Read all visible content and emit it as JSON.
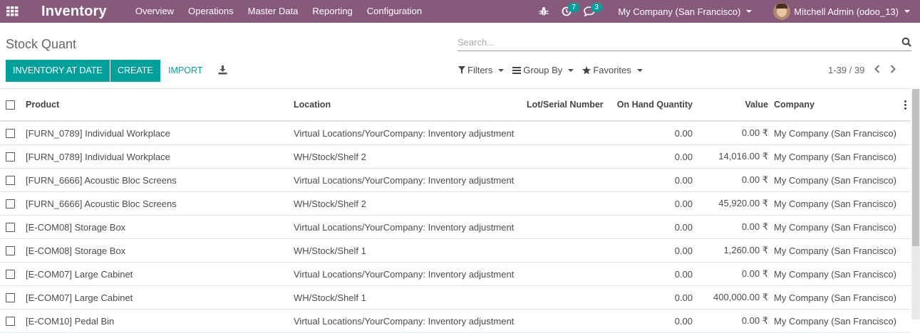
{
  "navbar": {
    "app_title": "Inventory",
    "menu": [
      "Overview",
      "Operations",
      "Master Data",
      "Reporting",
      "Configuration"
    ],
    "activity_count": "7",
    "messages_count": "3",
    "company": "My Company (San Francisco)",
    "user": "Mitchell Admin (odoo_13)",
    "icons": [
      "apps-grid-icon",
      "bug-icon",
      "clock-icon",
      "chat-icon",
      "user-avatar"
    ],
    "brand_color": "#875a7b",
    "accent_color": "#00a09d"
  },
  "control_panel": {
    "title": "Stock Quant",
    "search_placeholder": "Search...",
    "buttons": {
      "inventory_at_date": "Inventory at Date",
      "create": "Create",
      "import": "Import"
    },
    "filters": "Filters",
    "group_by": "Group By",
    "favorites": "Favorites",
    "pager": "1-39 / 39"
  },
  "table": {
    "columns": {
      "product": "Product",
      "location": "Location",
      "lot": "Lot/Serial Number",
      "qty": "On Hand Quantity",
      "value": "Value",
      "company": "Company"
    },
    "rows": [
      {
        "product": "[FURN_0789] Individual Workplace",
        "location": "Virtual Locations/YourCompany: Inventory adjustment",
        "lot": "",
        "qty": "0.00",
        "value": "0.00 ₹",
        "company": "My Company (San Francisco)"
      },
      {
        "product": "[FURN_0789] Individual Workplace",
        "location": "WH/Stock/Shelf 2",
        "lot": "",
        "qty": "0.00",
        "value": "14,016.00 ₹",
        "company": "My Company (San Francisco)"
      },
      {
        "product": "[FURN_6666] Acoustic Bloc Screens",
        "location": "Virtual Locations/YourCompany: Inventory adjustment",
        "lot": "",
        "qty": "0.00",
        "value": "0.00 ₹",
        "company": "My Company (San Francisco)"
      },
      {
        "product": "[FURN_6666] Acoustic Bloc Screens",
        "location": "WH/Stock/Shelf 2",
        "lot": "",
        "qty": "0.00",
        "value": "45,920.00 ₹",
        "company": "My Company (San Francisco)"
      },
      {
        "product": "[E-COM08] Storage Box",
        "location": "Virtual Locations/YourCompany: Inventory adjustment",
        "lot": "",
        "qty": "0.00",
        "value": "0.00 ₹",
        "company": "My Company (San Francisco)"
      },
      {
        "product": "[E-COM08] Storage Box",
        "location": "WH/Stock/Shelf 1",
        "lot": "",
        "qty": "0.00",
        "value": "1,260.00 ₹",
        "company": "My Company (San Francisco)"
      },
      {
        "product": "[E-COM07] Large Cabinet",
        "location": "Virtual Locations/YourCompany: Inventory adjustment",
        "lot": "",
        "qty": "0.00",
        "value": "0.00 ₹",
        "company": "My Company (San Francisco)"
      },
      {
        "product": "[E-COM07] Large Cabinet",
        "location": "WH/Stock/Shelf 1",
        "lot": "",
        "qty": "0.00",
        "value": "400,000.00 ₹",
        "company": "My Company (San Francisco)"
      },
      {
        "product": "[E-COM10] Pedal Bin",
        "location": "Virtual Locations/YourCompany: Inventory adjustment",
        "lot": "",
        "qty": "0.00",
        "value": "0.00 ₹",
        "company": "My Company (San Francisco)"
      }
    ]
  }
}
